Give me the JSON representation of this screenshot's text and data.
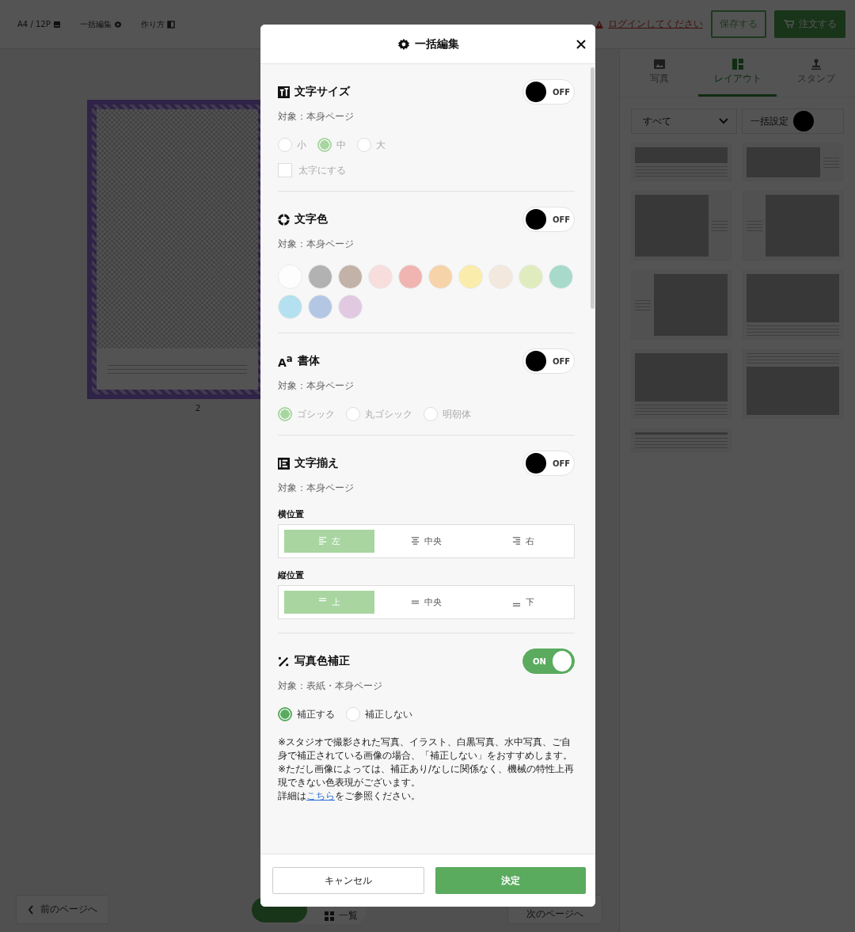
{
  "topbar": {
    "items": [
      {
        "label": "A4 / 12P"
      },
      {
        "label": "一括編集"
      },
      {
        "label": "作り方"
      }
    ],
    "login_link": "ログインしてください",
    "save_button": "保存する",
    "order_button": "注文する"
  },
  "canvas": {
    "page_number": "2"
  },
  "bottom_bar": {
    "prev_button": "前のページへ",
    "list_view": "一覧",
    "next_button": "次のページへ"
  },
  "side_panel": {
    "tabs": [
      {
        "label": "写真",
        "selected": false
      },
      {
        "label": "レイアウト",
        "selected": true
      },
      {
        "label": "スタンプ",
        "selected": false
      }
    ],
    "filter": {
      "value": "すべて"
    },
    "bulk_setting": {
      "label": "一括設定",
      "on": false
    }
  },
  "modal": {
    "title": "一括編集",
    "sections": [
      {
        "kind": "choice",
        "title": "文字サイズ",
        "toggle": {
          "label": "OFF",
          "on": false
        },
        "target": "対象：本身ページ",
        "options": [
          {
            "label": "小",
            "selected": false
          },
          {
            "label": "中",
            "selected": true
          },
          {
            "label": "大",
            "selected": false
          }
        ],
        "checkbox": {
          "label": "太字にする",
          "checked": false
        }
      },
      {
        "kind": "colors",
        "title": "文字色",
        "toggle": {
          "label": "OFF",
          "on": false
        },
        "target": "対象：本身ページ",
        "swatches": [
          {
            "color": "#ffffff"
          },
          {
            "color": "#a6a6a6"
          },
          {
            "color": "#b9a79b"
          },
          {
            "color": "#f9d9d9"
          },
          {
            "color": "#efaaa5"
          },
          {
            "color": "#f6cd9c"
          },
          {
            "color": "#fbeb9d"
          },
          {
            "color": "#f2e6d9"
          },
          {
            "color": "#dcebb5"
          },
          {
            "color": "#9ad6c3"
          },
          {
            "color": "#a9dcee"
          },
          {
            "color": "#a8bfe3"
          },
          {
            "color": "#dcc2de"
          }
        ]
      },
      {
        "kind": "choice",
        "icon_text": "A$^{a}$",
        "title": "書体",
        "toggle": {
          "label": "OFF",
          "on": false
        },
        "target": "対象：本身ページ",
        "options": [
          {
            "label": "ゴシック",
            "selected": true
          },
          {
            "label": "丸ゴシック",
            "selected": false
          },
          {
            "label": "明朝体",
            "selected": false
          }
        ]
      },
      {
        "kind": "align",
        "title": "文字揃え",
        "toggle": {
          "label": "OFF",
          "on": false
        },
        "target": "対象：本身ページ",
        "groups": [
          {
            "label": "横位置",
            "options": [
              {
                "label": "左",
                "selected": true
              },
              {
                "label": "中央",
                "selected": false
              },
              {
                "label": "右",
                "selected": false
              }
            ]
          },
          {
            "label": "縦位置",
            "options": [
              {
                "label": "上",
                "selected": true
              },
              {
                "label": "中央",
                "selected": false
              },
              {
                "label": "下",
                "selected": false
              }
            ]
          }
        ]
      },
      {
        "kind": "choice",
        "title": "写真色補正",
        "toggle": {
          "label": "ON",
          "on": true
        },
        "target": "対象：表紙・本身ページ",
        "options": [
          {
            "label": "補正する",
            "selected": true
          },
          {
            "label": "補正しない",
            "selected": false
          }
        ],
        "notes": [
          "※スタジオで撮影された写真、イラスト、白黒写真、水中写真、ご自身で補正されている画像の場合、「補正しない」をおすすめします。",
          "※ただし画像によっては、補正あり/なしに関係なく、機械の特性上再現できない色表現がございます。"
        ],
        "detail": {
          "before": "詳細は",
          "link": "こちら",
          "after": "をご参照ください。"
        }
      }
    ],
    "cancel_button": "キャンセル",
    "confirm_button": "決定"
  }
}
